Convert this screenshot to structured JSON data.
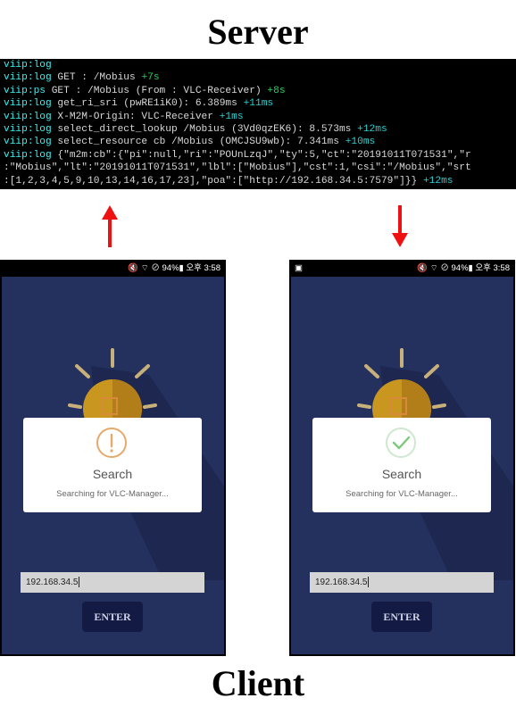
{
  "server_title": "Server",
  "client_title": "Client",
  "terminal": {
    "lines": [
      {
        "prefix": "viip:log",
        "text": "",
        "time": "",
        "time_color": "cyan"
      },
      {
        "prefix": "viip:log",
        "text": " GET : /Mobius ",
        "time": "+7s",
        "time_color": "green"
      },
      {
        "prefix": "viip:ps",
        "text": " GET : /Mobius (From : VLC-Receiver) ",
        "time": "+8s",
        "time_color": "green"
      },
      {
        "prefix": "viip:log",
        "text": " get_ri_sri (pwRE1iK0): 6.389ms ",
        "time": "+11ms",
        "time_color": "cyan"
      },
      {
        "prefix": "viip:log",
        "text": " X-M2M-Origin: VLC-Receiver ",
        "time": "+1ms",
        "time_color": "cyan"
      },
      {
        "prefix": "viip:log",
        "text": " select_direct_lookup /Mobius (3Vd0qzEK6): 8.573ms ",
        "time": "+12ms",
        "time_color": "cyan"
      },
      {
        "prefix": "viip:log",
        "text": " select_resource cb /Mobius (OMCJSU9wb): 7.341ms ",
        "time": "+10ms",
        "time_color": "cyan"
      },
      {
        "prefix": "viip:log",
        "text": " {\"m2m:cb\":{\"pi\":null,\"ri\":\"POUnLzqJ\",\"ty\":5,\"ct\":\"20191011T071531\",\"r",
        "time": "",
        "time_color": "cyan"
      },
      {
        "prefix": "",
        "text": ":\"Mobius\",\"lt\":\"20191011T071531\",\"lbl\":[\"Mobius\"],\"cst\":1,\"csi\":\"/Mobius\",\"srt",
        "time": "",
        "time_color": "cyan"
      },
      {
        "prefix": "",
        "text": ":[1,2,3,4,5,9,10,13,14,16,17,23],\"poa\":[\"http://192.168.34.5:7579\"]}} ",
        "time": "+12ms",
        "time_color": "cyan"
      }
    ]
  },
  "phones": [
    {
      "status_right": "🔇 ⌔ ⊘ 94%▮ 오후 3:58",
      "status_left": "",
      "dialog_title": "Search",
      "dialog_message": "Searching for VLC-Manager...",
      "dialog_icon": "warning-circle-icon",
      "ip_value": "192.168.34.5",
      "enter_label": "ENTER",
      "arrow_direction": "up"
    },
    {
      "status_right": "🔇 ⌔ ⊘ 94%▮ 오후 3:58",
      "status_left": "▣",
      "dialog_title": "Search",
      "dialog_message": "Searching for VLC-Manager...",
      "dialog_icon": "success-check-icon",
      "ip_value": "192.168.34.5",
      "enter_label": "ENTER",
      "arrow_direction": "down"
    }
  ],
  "colors": {
    "arrow": "#ee1111",
    "screen_bg": "#24305e",
    "warning": "#e8a86a",
    "success": "#7ec87e"
  }
}
